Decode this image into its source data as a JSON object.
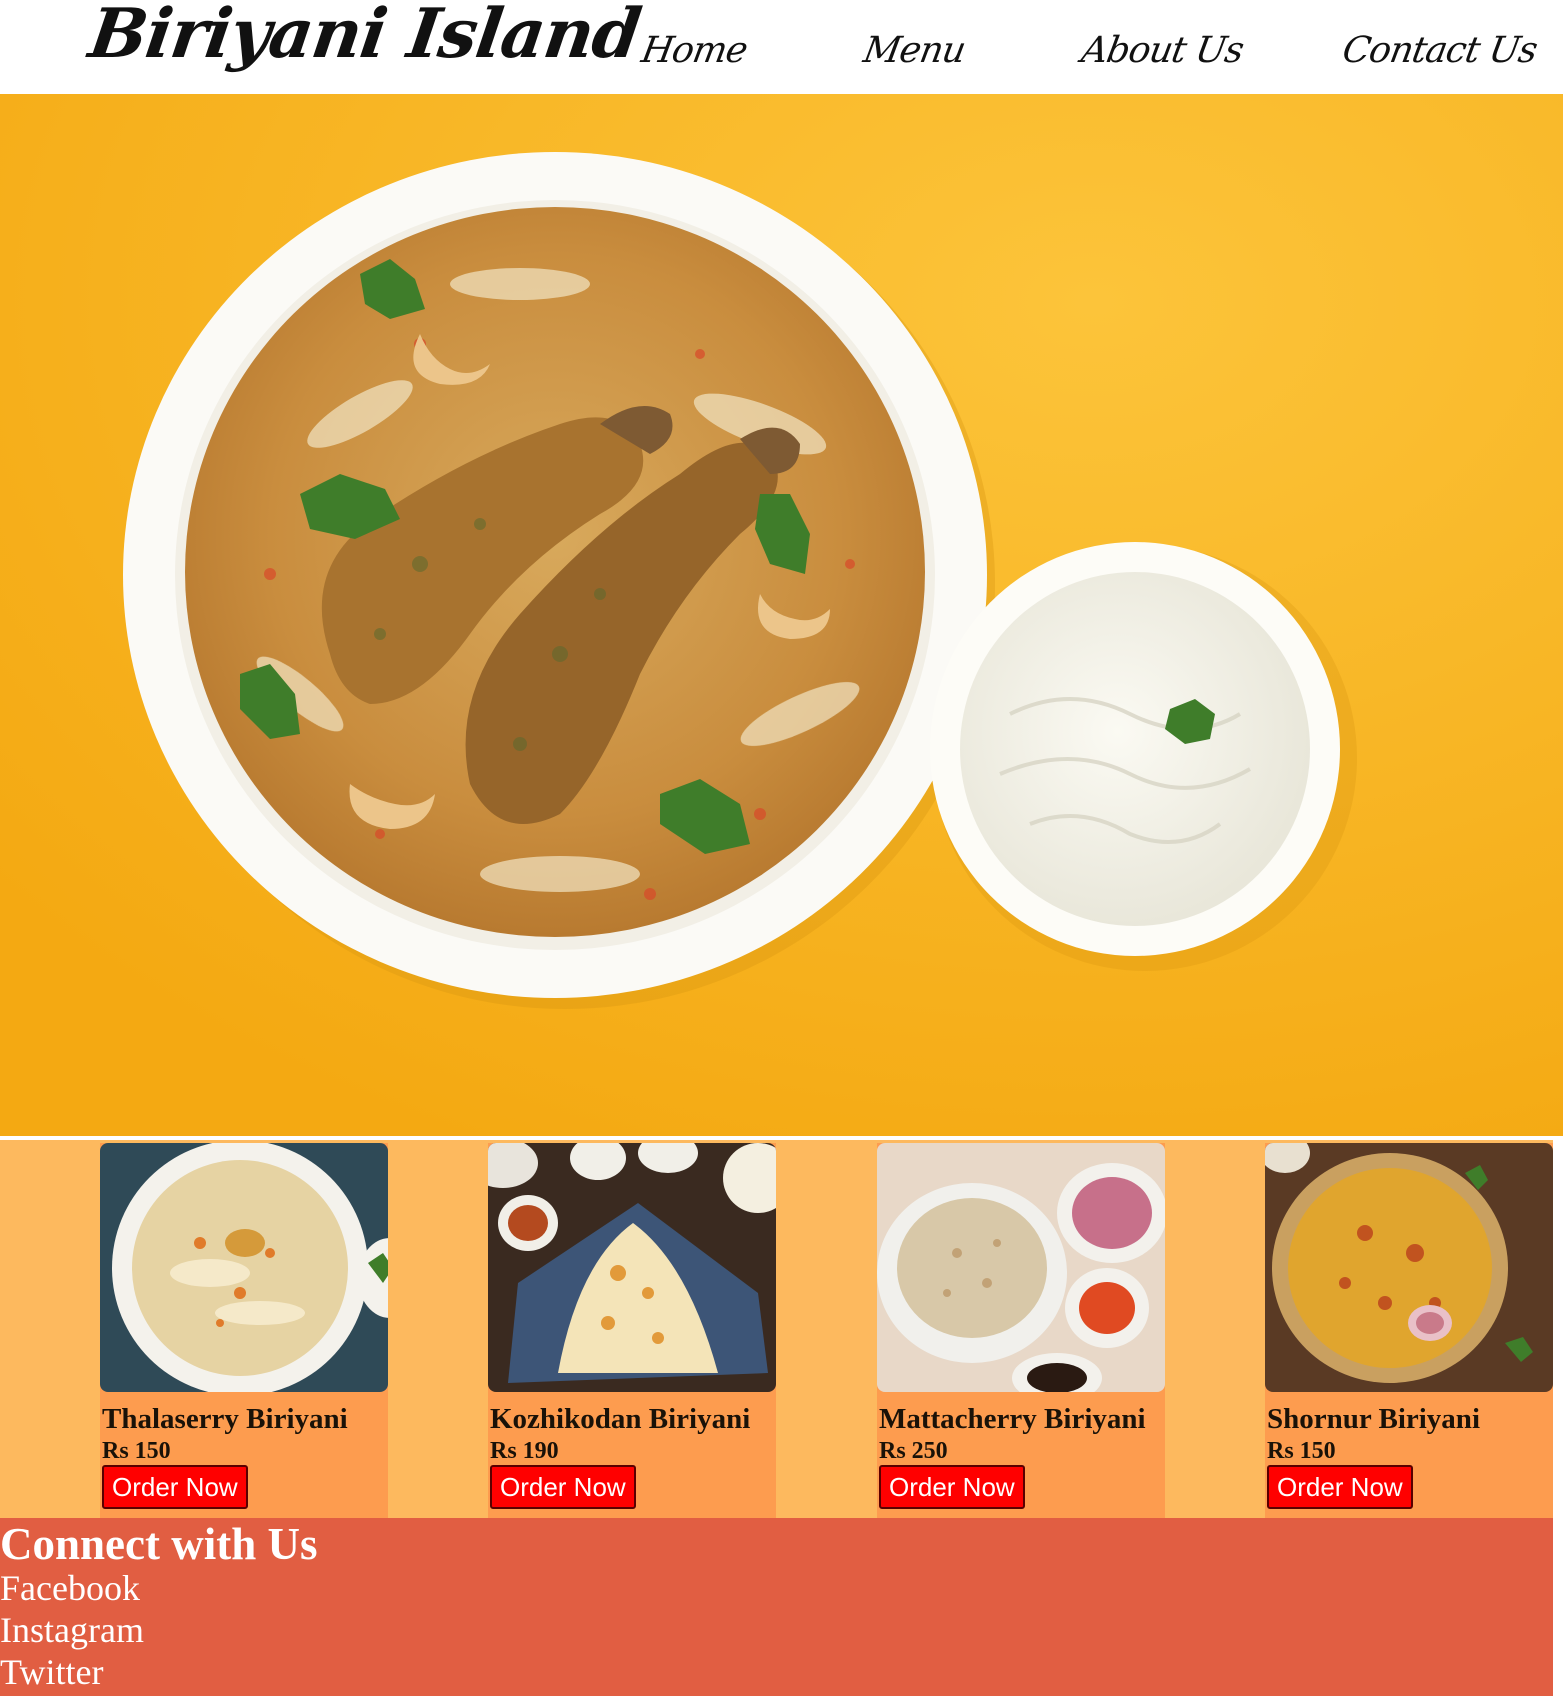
{
  "header": {
    "brand": "Biriyani Island",
    "nav": [
      {
        "label": "Home"
      },
      {
        "label": "Menu"
      },
      {
        "label": "About Us"
      },
      {
        "label": "Contact Us"
      }
    ]
  },
  "colors": {
    "hero_background": "#f9b41e",
    "menu_strip": "#fdb95e",
    "card_background": "#fd9c4f",
    "order_button": "#ff0000",
    "footer": "#e15e42"
  },
  "menu": {
    "items": [
      {
        "name": "Thalaserry Biriyani",
        "price": "Rs 150",
        "button": "Order Now"
      },
      {
        "name": "Kozhikodan Biriyani",
        "price": "Rs 190",
        "button": "Order Now"
      },
      {
        "name": "Mattacherry Biriyani",
        "price": "Rs 250",
        "button": "Order Now"
      },
      {
        "name": "Shornur Biriyani",
        "price": "Rs 150",
        "button": "Order Now"
      }
    ]
  },
  "footer": {
    "title": "Connect with Us",
    "links": [
      {
        "label": "Facebook"
      },
      {
        "label": "Instagram"
      },
      {
        "label": "Twitter"
      }
    ]
  }
}
